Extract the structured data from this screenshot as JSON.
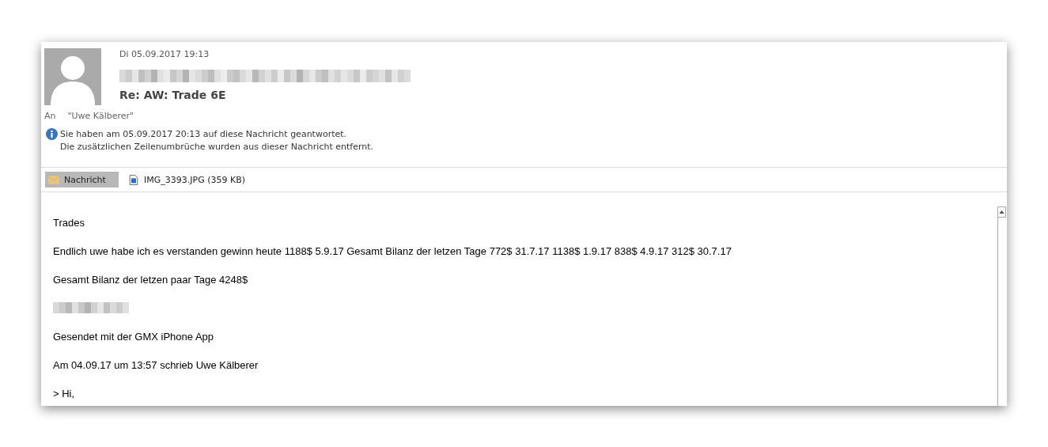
{
  "message": {
    "date": "Di 05.09.2017 19:13",
    "sender_redacted": true,
    "subject": "Re: AW: Trade 6E",
    "to_label": "An",
    "to": "\"Uwe Kälberer\"",
    "info": [
      "Sie haben am 05.09.2017 20:13 auf diese Nachricht geantwortet.",
      "Die zusätzlichen Zeilenumbrüche wurden aus dieser Nachricht entfernt."
    ]
  },
  "attachments": [
    {
      "kind": "message",
      "label": "Nachricht",
      "selected": true
    },
    {
      "kind": "image",
      "label": "IMG_3393.JPG (359 KB)",
      "selected": false
    }
  ],
  "body": [
    {
      "kind": "text",
      "text": "Trades"
    },
    {
      "kind": "text",
      "text": "Endlich uwe habe ich es verstanden gewinn heute 1188$ 5.9.17 Gesamt Bilanz der letzen Tage 772$ 31.7.17 1138$ 1.9.17 838$ 4.9.17 312$  30.7.17"
    },
    {
      "kind": "text",
      "text": "Gesamt Bilanz der letzen paar Tage 4248$"
    },
    {
      "kind": "redacted"
    },
    {
      "kind": "text",
      "text": "Gesendet mit der GMX iPhone App"
    },
    {
      "kind": "text",
      "text": "Am 04.09.17 um 13:57 schrieb Uwe Kälberer"
    },
    {
      "kind": "text",
      "text": "> Hi,"
    }
  ]
}
